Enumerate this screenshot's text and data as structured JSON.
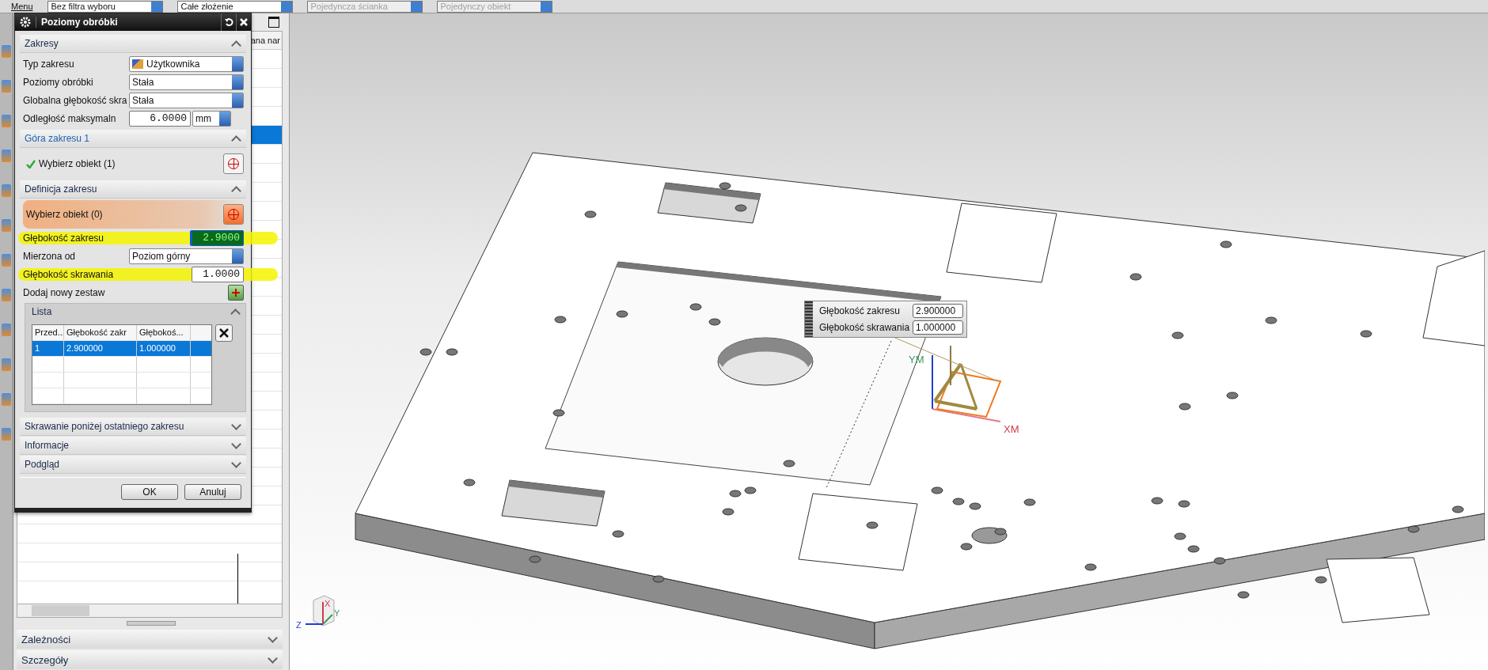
{
  "toolbar": {
    "menu": "Menu",
    "dropdowns": [
      {
        "label": "Bez filtra wyboru",
        "disabled": false
      },
      {
        "label": "Całe złożenie",
        "disabled": false
      },
      {
        "label": "Pojedyncza ścianka",
        "disabled": true
      },
      {
        "label": "Pojedynczy obiekt",
        "disabled": true
      }
    ]
  },
  "navigator": {
    "column_header": "ana nar",
    "rows": [
      {
        "selected": false
      },
      {
        "selected": false
      },
      {
        "selected": false
      },
      {
        "selected": false
      },
      {
        "selected": true
      },
      {
        "selected": false
      },
      {
        "selected": false
      },
      {
        "selected": false
      },
      {
        "selected": false
      },
      {
        "selected": false
      },
      {
        "selected": false
      },
      {
        "selected": false
      },
      {
        "selected": false
      },
      {
        "selected": false
      },
      {
        "selected": false
      },
      {
        "selected": false
      },
      {
        "selected": false
      },
      {
        "selected": false
      },
      {
        "selected": false
      },
      {
        "selected": false
      },
      {
        "selected": false
      },
      {
        "selected": false
      },
      {
        "selected": false
      },
      {
        "selected": false
      },
      {
        "selected": false
      },
      {
        "selected": false
      },
      {
        "selected": false
      },
      {
        "selected": false
      }
    ],
    "panels": [
      {
        "title": "Zależności",
        "expanded": false
      },
      {
        "title": "Szczegóły",
        "expanded": false
      }
    ]
  },
  "dialog": {
    "title": "Poziomy obróbki",
    "sections": [
      {
        "title": "Zakresy",
        "expanded": true,
        "active": false,
        "rows": [
          {
            "kind": "select",
            "label": "Typ zakresu",
            "value": "Użytkownika",
            "with_icon": true
          },
          {
            "kind": "select",
            "label": "Poziomy obróbki",
            "value": "Stała"
          },
          {
            "kind": "select",
            "label": "Globalna głębokość skra",
            "value": "Stała"
          },
          {
            "kind": "number_unit",
            "label": "Odległość maksymaln",
            "value": "6.0000",
            "unit": "mm"
          }
        ]
      },
      {
        "title": "Góra zakresu 1",
        "expanded": true,
        "active": true,
        "rows": [
          {
            "kind": "selection",
            "label": "Wybierz obiekt (1)",
            "done": true,
            "active": false
          }
        ]
      },
      {
        "title": "Definicja zakresu",
        "expanded": true,
        "active": false,
        "rows": [
          {
            "kind": "selection",
            "label": "Wybierz obiekt (0)",
            "done": false,
            "active": true
          },
          {
            "kind": "number",
            "label": "Głębokość zakresu",
            "value": "2.9000",
            "highlighted": true,
            "selected": true
          },
          {
            "kind": "select",
            "label": "Mierzona od",
            "value": "Poziom górny"
          },
          {
            "kind": "number",
            "label": "Głębokość skrawania",
            "value": "1.0000",
            "highlighted": true,
            "selected": false
          },
          {
            "kind": "add",
            "label": "Dodaj nowy zestaw"
          },
          {
            "kind": "list",
            "title": "Lista",
            "expanded": true,
            "columns": [
              "Przed...",
              "Głębokość zakr",
              "Głębokoś..."
            ],
            "rows": [
              {
                "cells": [
                  "1",
                  "2.900000",
                  "1.000000"
                ],
                "selected": true
              }
            ]
          }
        ]
      },
      {
        "title": "Skrawanie poniżej ostatniego zakresu",
        "expanded": false,
        "active": false
      },
      {
        "title": "Informacje",
        "expanded": false,
        "active": false
      },
      {
        "title": "Podgląd",
        "expanded": false,
        "active": false
      }
    ],
    "buttons": [
      "OK",
      "Anuluj"
    ]
  },
  "viewport": {
    "tooltip": [
      {
        "label": "Głębokość zakresu",
        "value": "2.900000"
      },
      {
        "label": "Głębokość skrawania",
        "value": "1.000000"
      }
    ],
    "wcs_labels": [
      "YM",
      "XM"
    ],
    "triad_labels": [
      "Z",
      "X",
      "Y"
    ]
  }
}
